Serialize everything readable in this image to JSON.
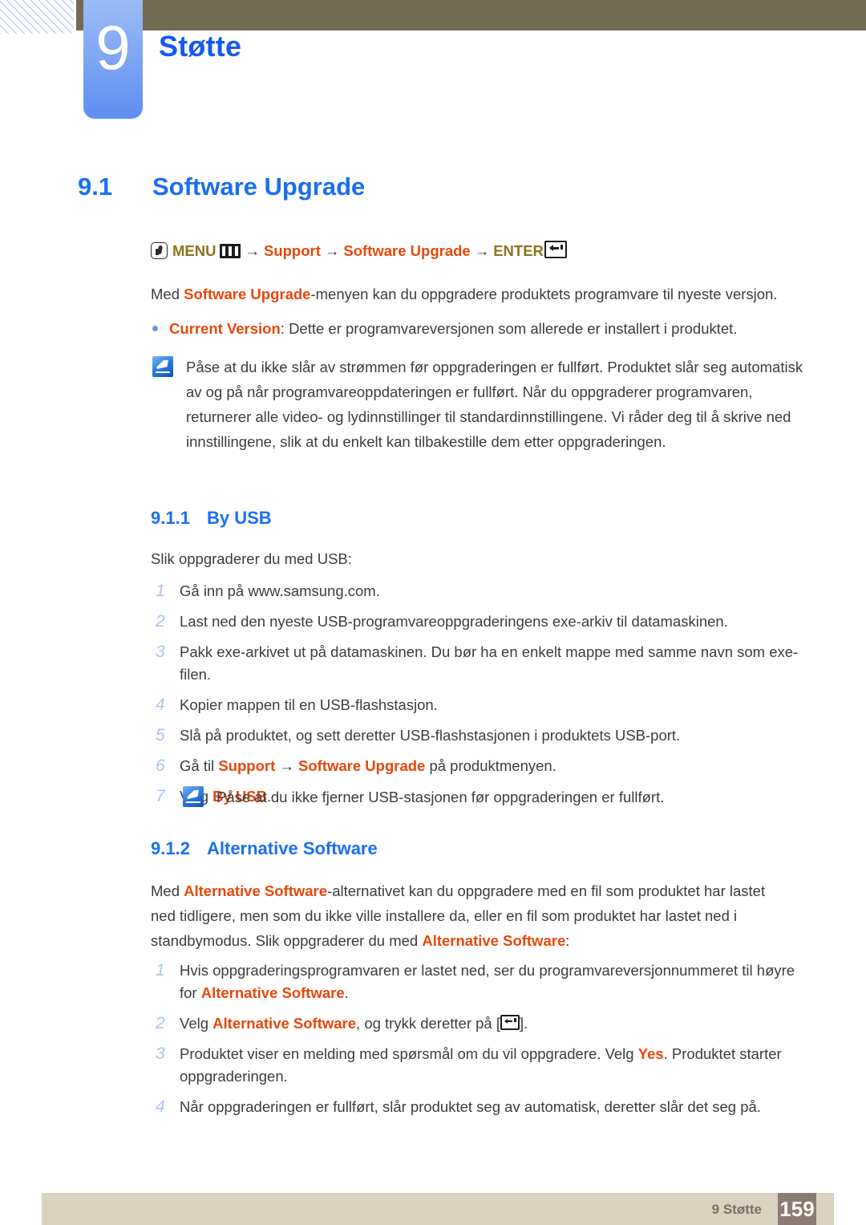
{
  "header": {
    "chapter_number": "9",
    "chapter_title": "Støtte"
  },
  "section": {
    "number": "9.1",
    "title": "Software Upgrade"
  },
  "menu_path": {
    "menu_label": "MENU",
    "arrow": "→",
    "item1": "Support",
    "item2": "Software Upgrade",
    "enter_label": "ENTER",
    "hand_icon": "hand-press-icon",
    "menu_icon": "menu-bars-icon",
    "enter_icon": "enter-key-icon"
  },
  "intro": {
    "pre": "Med ",
    "term": "Software Upgrade",
    "post": "-menyen kan du oppgradere produktets programvare til nyeste versjon."
  },
  "bullet": {
    "term": "Current Version",
    "text": ": Dette er programvareversjonen som allerede er installert i produktet."
  },
  "note_main": {
    "text": "Påse at du ikke slår av strømmen før oppgraderingen er fullført. Produktet slår seg automatisk av og på når programvareoppdateringen er fullført. Når du oppgraderer programvaren, returnerer alle video- og lydinnstillinger til standardinnstillingene. Vi råder deg til å skrive ned innstillingene, slik at du enkelt kan tilbakestille dem etter oppgraderingen."
  },
  "subsection_usb": {
    "number": "9.1.1",
    "title": "By USB",
    "lead": "Slik oppgraderer du med USB:",
    "steps": [
      {
        "num": "1",
        "parts": [
          {
            "t": "Gå inn på www.samsung.com.",
            "s": "plain"
          }
        ]
      },
      {
        "num": "2",
        "parts": [
          {
            "t": "Last ned den nyeste USB-programvareoppgraderingens exe-arkiv til datamaskinen.",
            "s": "plain"
          }
        ]
      },
      {
        "num": "3",
        "parts": [
          {
            "t": "Pakk exe-arkivet ut på datamaskinen. Du bør ha en enkelt mappe med samme navn som exe-filen.",
            "s": "plain"
          }
        ]
      },
      {
        "num": "4",
        "parts": [
          {
            "t": "Kopier mappen til en USB-flashstasjon.",
            "s": "plain"
          }
        ]
      },
      {
        "num": "5",
        "parts": [
          {
            "t": "Slå på produktet, og sett deretter USB-flashstasjonen i produktets USB-port.",
            "s": "plain"
          }
        ]
      },
      {
        "num": "6",
        "parts": [
          {
            "t": "Gå til ",
            "s": "plain"
          },
          {
            "t": "Support",
            "s": "orange"
          },
          {
            "t": " → ",
            "s": "plain"
          },
          {
            "t": "Software Upgrade",
            "s": "orange"
          },
          {
            "t": " på produktmenyen.",
            "s": "plain"
          }
        ]
      },
      {
        "num": "7",
        "parts": [
          {
            "t": "Velg ",
            "s": "plain"
          },
          {
            "t": "By USB",
            "s": "orange"
          },
          {
            "t": ".",
            "s": "plain"
          }
        ]
      }
    ],
    "note": "Påse at du ikke fjerner USB-stasjonen før oppgraderingen er fullført."
  },
  "subsection_alt": {
    "number": "9.1.2",
    "title": "Alternative Software",
    "intro_parts": [
      {
        "t": "Med ",
        "s": "plain"
      },
      {
        "t": "Alternative Software",
        "s": "orange"
      },
      {
        "t": "-alternativet kan du oppgradere med en fil som produktet har lastet ned tidligere, men som du ikke ville installere da, eller en fil som produktet har lastet ned i standbymodus. Slik oppgraderer du med ",
        "s": "plain"
      },
      {
        "t": "Alternative Software",
        "s": "orange"
      },
      {
        "t": ":",
        "s": "plain"
      }
    ],
    "steps": [
      {
        "num": "1",
        "parts": [
          {
            "t": "Hvis oppgraderingsprogramvaren er lastet ned, ser du programvareversjonnummeret til høyre for ",
            "s": "plain"
          },
          {
            "t": "Alternative Software",
            "s": "orange"
          },
          {
            "t": ".",
            "s": "plain"
          }
        ]
      },
      {
        "num": "2",
        "parts": [
          {
            "t": "Velg ",
            "s": "plain"
          },
          {
            "t": "Alternative Software",
            "s": "orange"
          },
          {
            "t": ", og trykk deretter på [",
            "s": "plain"
          },
          {
            "t": "",
            "s": "enter-icon"
          },
          {
            "t": "].",
            "s": "plain"
          }
        ]
      },
      {
        "num": "3",
        "parts": [
          {
            "t": "Produktet viser en melding med spørsmål om du vil oppgradere. Velg ",
            "s": "plain"
          },
          {
            "t": "Yes",
            "s": "orange"
          },
          {
            "t": ". Produktet starter oppgraderingen.",
            "s": "plain"
          }
        ]
      },
      {
        "num": "4",
        "parts": [
          {
            "t": "Når oppgraderingen er fullført, slår produktet seg av automatisk, deretter slår det seg på.",
            "s": "plain"
          }
        ]
      }
    ]
  },
  "footer": {
    "label": "9 Støtte",
    "page": "159"
  },
  "colors": {
    "accent_blue": "#1a6ef6",
    "term_orange": "#e8470a",
    "menu_gold": "#8a7420",
    "olive_bar": "#726c52",
    "footer_bar": "#d9d2bf",
    "footer_page_box": "#8c7b70",
    "list_number": "#a9c3ef"
  }
}
